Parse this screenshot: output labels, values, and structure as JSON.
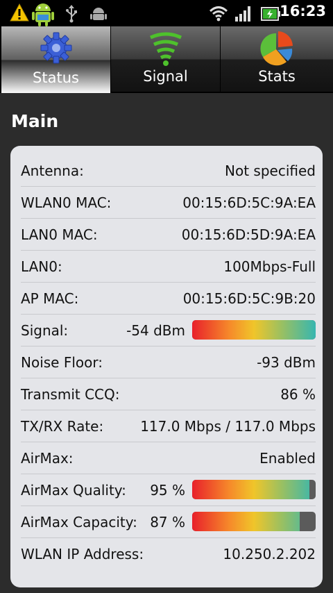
{
  "statusbar": {
    "time": "16:23",
    "icons": [
      "warning-icon",
      "android-icon",
      "usb-icon",
      "android-debug-icon",
      "wifi-icon",
      "cell-signal-icon",
      "battery-icon"
    ]
  },
  "tabs": [
    {
      "label": "Status",
      "icon": "gear-icon",
      "active": true
    },
    {
      "label": "Signal",
      "icon": "signal-icon",
      "active": false
    },
    {
      "label": "Stats",
      "icon": "pie-chart-icon",
      "active": false
    }
  ],
  "main": {
    "title": "Main",
    "rows": [
      {
        "label": "Antenna:",
        "value": "Not specified"
      },
      {
        "label": "WLAN0 MAC:",
        "value": "00:15:6D:5C:9A:EA"
      },
      {
        "label": "LAN0 MAC:",
        "value": "00:15:6D:5D:9A:EA"
      },
      {
        "label": "LAN0:",
        "value": "100Mbps-Full"
      },
      {
        "label": "AP MAC:",
        "value": "00:15:6D:5C:9B:20"
      },
      {
        "label": "Signal:",
        "value": "-54 dBm",
        "bar_level": 1.0
      },
      {
        "label": "Noise Floor:",
        "value": "-93 dBm"
      },
      {
        "label": "Transmit CCQ:",
        "value": "86 %"
      },
      {
        "label": "TX/RX Rate:",
        "value": "117.0 Mbps / 117.0 Mbps"
      },
      {
        "label": "AirMax:",
        "value": "Enabled"
      },
      {
        "label": "AirMax Quality:",
        "value": "95 %",
        "bar_level": 0.95
      },
      {
        "label": "AirMax Capacity:",
        "value": "87 %",
        "bar_level": 0.87
      },
      {
        "label": "WLAN IP Address:",
        "value": "10.250.2.202"
      }
    ]
  },
  "colors": {
    "bar_low": "#e8202b",
    "bar_mid": "#f0c52a",
    "bar_high": "#37b6b0",
    "bar_empty": "#5b5b5b",
    "card_bg": "#e4e5e9",
    "screen_bg": "#2c2c2c"
  }
}
